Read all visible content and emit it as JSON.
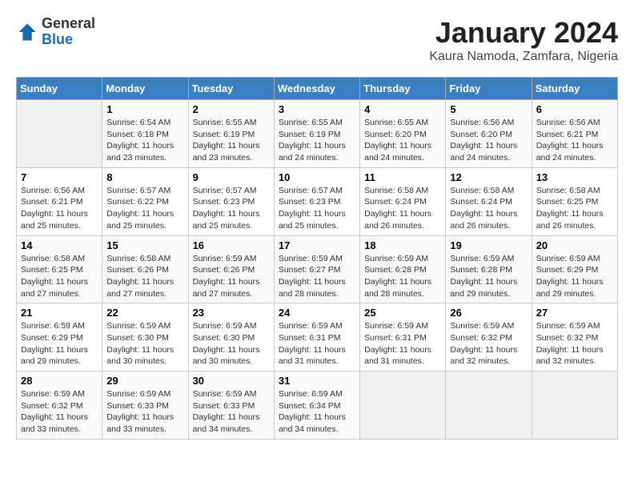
{
  "logo": {
    "general": "General",
    "blue": "Blue"
  },
  "title": "January 2024",
  "subtitle": "Kaura Namoda, Zamfara, Nigeria",
  "days_of_week": [
    "Sunday",
    "Monday",
    "Tuesday",
    "Wednesday",
    "Thursday",
    "Friday",
    "Saturday"
  ],
  "weeks": [
    [
      {
        "day": "",
        "info": ""
      },
      {
        "day": "1",
        "info": "Sunrise: 6:54 AM\nSunset: 6:18 PM\nDaylight: 11 hours\nand 23 minutes."
      },
      {
        "day": "2",
        "info": "Sunrise: 6:55 AM\nSunset: 6:19 PM\nDaylight: 11 hours\nand 23 minutes."
      },
      {
        "day": "3",
        "info": "Sunrise: 6:55 AM\nSunset: 6:19 PM\nDaylight: 11 hours\nand 24 minutes."
      },
      {
        "day": "4",
        "info": "Sunrise: 6:55 AM\nSunset: 6:20 PM\nDaylight: 11 hours\nand 24 minutes."
      },
      {
        "day": "5",
        "info": "Sunrise: 6:56 AM\nSunset: 6:20 PM\nDaylight: 11 hours\nand 24 minutes."
      },
      {
        "day": "6",
        "info": "Sunrise: 6:56 AM\nSunset: 6:21 PM\nDaylight: 11 hours\nand 24 minutes."
      }
    ],
    [
      {
        "day": "7",
        "info": "Sunrise: 6:56 AM\nSunset: 6:21 PM\nDaylight: 11 hours\nand 25 minutes."
      },
      {
        "day": "8",
        "info": "Sunrise: 6:57 AM\nSunset: 6:22 PM\nDaylight: 11 hours\nand 25 minutes."
      },
      {
        "day": "9",
        "info": "Sunrise: 6:57 AM\nSunset: 6:23 PM\nDaylight: 11 hours\nand 25 minutes."
      },
      {
        "day": "10",
        "info": "Sunrise: 6:57 AM\nSunset: 6:23 PM\nDaylight: 11 hours\nand 25 minutes."
      },
      {
        "day": "11",
        "info": "Sunrise: 6:58 AM\nSunset: 6:24 PM\nDaylight: 11 hours\nand 26 minutes."
      },
      {
        "day": "12",
        "info": "Sunrise: 6:58 AM\nSunset: 6:24 PM\nDaylight: 11 hours\nand 26 minutes."
      },
      {
        "day": "13",
        "info": "Sunrise: 6:58 AM\nSunset: 6:25 PM\nDaylight: 11 hours\nand 26 minutes."
      }
    ],
    [
      {
        "day": "14",
        "info": "Sunrise: 6:58 AM\nSunset: 6:25 PM\nDaylight: 11 hours\nand 27 minutes."
      },
      {
        "day": "15",
        "info": "Sunrise: 6:58 AM\nSunset: 6:26 PM\nDaylight: 11 hours\nand 27 minutes."
      },
      {
        "day": "16",
        "info": "Sunrise: 6:59 AM\nSunset: 6:26 PM\nDaylight: 11 hours\nand 27 minutes."
      },
      {
        "day": "17",
        "info": "Sunrise: 6:59 AM\nSunset: 6:27 PM\nDaylight: 11 hours\nand 28 minutes."
      },
      {
        "day": "18",
        "info": "Sunrise: 6:59 AM\nSunset: 6:28 PM\nDaylight: 11 hours\nand 28 minutes."
      },
      {
        "day": "19",
        "info": "Sunrise: 6:59 AM\nSunset: 6:28 PM\nDaylight: 11 hours\nand 29 minutes."
      },
      {
        "day": "20",
        "info": "Sunrise: 6:59 AM\nSunset: 6:29 PM\nDaylight: 11 hours\nand 29 minutes."
      }
    ],
    [
      {
        "day": "21",
        "info": "Sunrise: 6:59 AM\nSunset: 6:29 PM\nDaylight: 11 hours\nand 29 minutes."
      },
      {
        "day": "22",
        "info": "Sunrise: 6:59 AM\nSunset: 6:30 PM\nDaylight: 11 hours\nand 30 minutes."
      },
      {
        "day": "23",
        "info": "Sunrise: 6:59 AM\nSunset: 6:30 PM\nDaylight: 11 hours\nand 30 minutes."
      },
      {
        "day": "24",
        "info": "Sunrise: 6:59 AM\nSunset: 6:31 PM\nDaylight: 11 hours\nand 31 minutes."
      },
      {
        "day": "25",
        "info": "Sunrise: 6:59 AM\nSunset: 6:31 PM\nDaylight: 11 hours\nand 31 minutes."
      },
      {
        "day": "26",
        "info": "Sunrise: 6:59 AM\nSunset: 6:32 PM\nDaylight: 11 hours\nand 32 minutes."
      },
      {
        "day": "27",
        "info": "Sunrise: 6:59 AM\nSunset: 6:32 PM\nDaylight: 11 hours\nand 32 minutes."
      }
    ],
    [
      {
        "day": "28",
        "info": "Sunrise: 6:59 AM\nSunset: 6:32 PM\nDaylight: 11 hours\nand 33 minutes."
      },
      {
        "day": "29",
        "info": "Sunrise: 6:59 AM\nSunset: 6:33 PM\nDaylight: 11 hours\nand 33 minutes."
      },
      {
        "day": "30",
        "info": "Sunrise: 6:59 AM\nSunset: 6:33 PM\nDaylight: 11 hours\nand 34 minutes."
      },
      {
        "day": "31",
        "info": "Sunrise: 6:59 AM\nSunset: 6:34 PM\nDaylight: 11 hours\nand 34 minutes."
      },
      {
        "day": "",
        "info": ""
      },
      {
        "day": "",
        "info": ""
      },
      {
        "day": "",
        "info": ""
      }
    ]
  ]
}
